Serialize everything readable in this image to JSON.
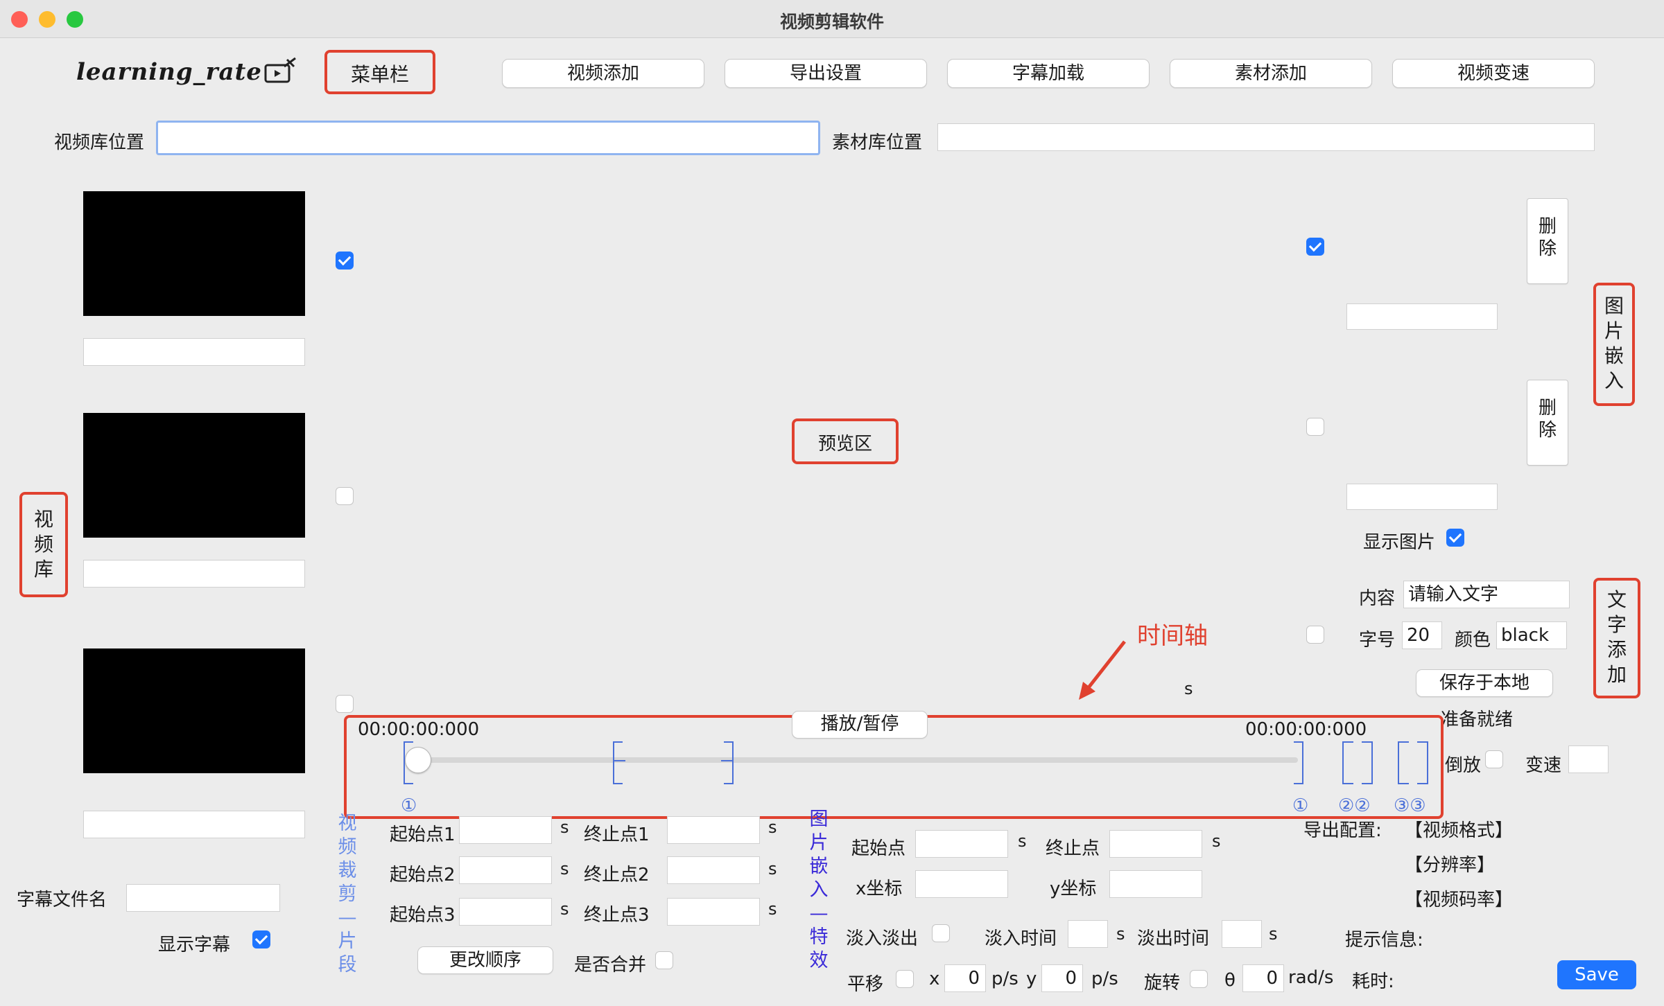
{
  "window": {
    "title": "视频剪辑软件"
  },
  "logo": {
    "text": "learning_rate",
    "icon": "video-edit-icon"
  },
  "toolbar": {
    "menu_bar_label": "菜单栏",
    "buttons": [
      "视频添加",
      "导出设置",
      "字幕加载",
      "素材添加",
      "视频变速"
    ]
  },
  "paths": {
    "video_library_label": "视频库位置",
    "video_library_value": "",
    "material_library_label": "素材库位置",
    "material_library_value": ""
  },
  "annotations": {
    "video_library": "视频库",
    "preview_area": "预览区",
    "image_embed": "图片嵌入",
    "text_add": "文字添加",
    "timeline": "时间轴"
  },
  "images": {
    "delete_label": "删除",
    "show_image_label": "显示图片"
  },
  "text_overlay": {
    "content_label": "内容",
    "content_value": "请输入文字",
    "font_size_label": "字号",
    "font_size_value": "20",
    "color_label": "颜色",
    "color_value": "black",
    "save_local_label": "保存于本地",
    "status": "准备就绪"
  },
  "player": {
    "play_pause_label": "播放/暂停",
    "time_start": "00:00:00:000",
    "time_end": "00:00:00:000",
    "s_unit": "s",
    "marker_1": "①",
    "marker_2": "②②",
    "marker_3": "③③"
  },
  "speed": {
    "reverse_label": "倒放",
    "speed_label": "变速",
    "speed_value": ""
  },
  "subtitle": {
    "file_label": "字幕文件名",
    "file_value": "",
    "show_label": "显示字幕"
  },
  "clip_section": {
    "side_label": "视频裁剪—片段",
    "start1": "起始点1",
    "end1": "终止点1",
    "start2": "起始点2",
    "end2": "终止点2",
    "start3": "起始点3",
    "end3": "终止点3",
    "unit": "s",
    "reorder_label": "更改顺序",
    "merge_label": "是否合并"
  },
  "effects_section": {
    "side_label": "图片嵌入—特效",
    "start_label": "起始点",
    "end_label": "终止点",
    "x_label": "x坐标",
    "y_label": "y坐标",
    "fade_label": "淡入淡出",
    "fade_in_label": "淡入时间",
    "fade_out_label": "淡出时间",
    "unit": "s",
    "translate_label": "平移",
    "x_short": "x",
    "y_short": "y",
    "x_value": "0",
    "y_value": "0",
    "px_unit": "p/s",
    "rotate_label": "旋转",
    "theta_label": "θ",
    "theta_value": "0",
    "rad_unit": "rad/s"
  },
  "export": {
    "config_label": "导出配置:",
    "format_label": "【视频格式】",
    "resolution_label": "【分辨率】",
    "bitrate_label": "【视频码率】",
    "hint_label": "提示信息:",
    "elapsed_label": "耗时:",
    "save_label": "Save"
  },
  "colors": {
    "accent": "#1f75fe",
    "annotation_red": "#e0412f",
    "timeline_blue": "#4a6fd8"
  }
}
